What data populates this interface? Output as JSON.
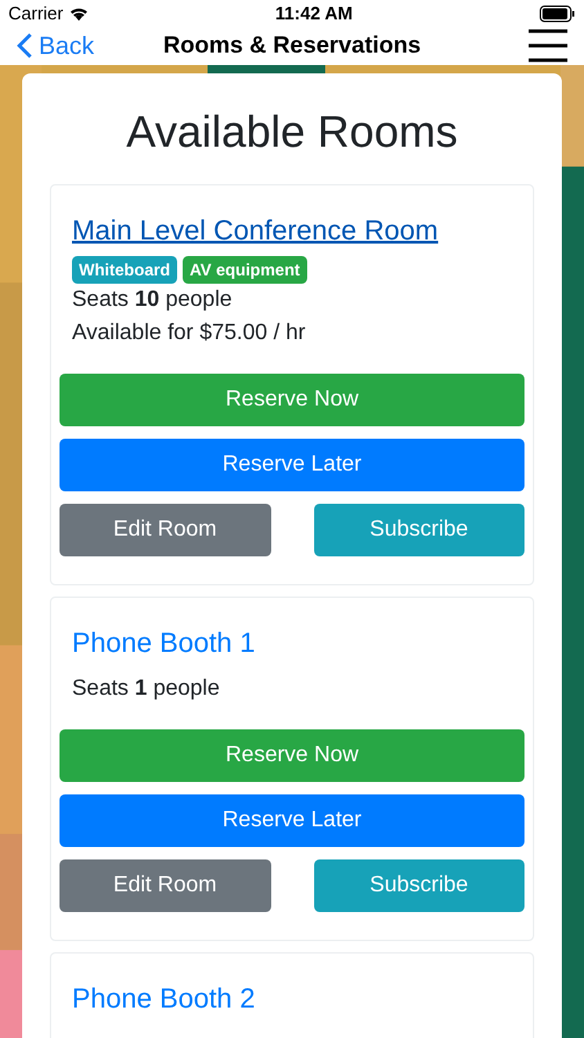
{
  "status_bar": {
    "carrier": "Carrier",
    "time": "11:42 AM"
  },
  "nav": {
    "back": "Back",
    "title": "Rooms & Reservations"
  },
  "heading": "Available Rooms",
  "rooms": [
    {
      "name": "Main Level Conference Room",
      "selected": true,
      "tags": [
        {
          "label": "Whiteboard",
          "color": "#17a2b8"
        },
        {
          "label": "AV equipment",
          "color": "#28a745"
        }
      ],
      "details": [
        "Seats **10** people",
        "Available for $75.00 / hr"
      ],
      "actions": [
        {
          "label": "Reserve Now",
          "kind": "success"
        },
        {
          "label": "Reserve Later",
          "kind": "primary"
        },
        {
          "label": "Edit Room",
          "kind": "secondary"
        },
        {
          "label": "Subscribe",
          "kind": "info"
        }
      ]
    },
    {
      "name": "Phone Booth 1",
      "selected": false,
      "details": [
        "Seats **1** people"
      ],
      "actions": [
        {
          "label": "Reserve Now",
          "kind": "success"
        },
        {
          "label": "Reserve Later",
          "kind": "primary"
        },
        {
          "label": "Edit Room",
          "kind": "secondary"
        },
        {
          "label": "Subscribe",
          "kind": "info"
        }
      ]
    },
    {
      "name": "Phone Booth 2",
      "selected": false
    }
  ]
}
